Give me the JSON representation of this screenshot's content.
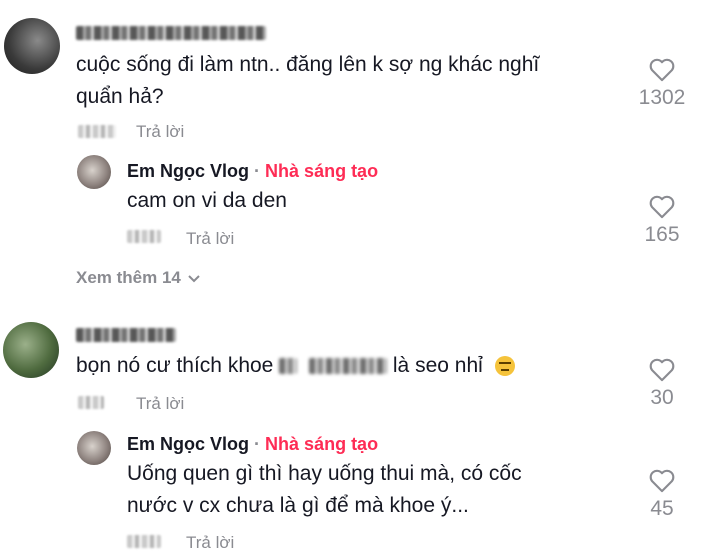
{
  "colors": {
    "creator_badge": "#fe2c55",
    "muted": "#8a8b91",
    "text": "#161823"
  },
  "reply_label": "Trả lời",
  "comments": [
    {
      "text_lines": [
        "cuộc sống đi làm ntn.. đăng lên k sợ ng khác nghĩ",
        "quẩn hả?"
      ],
      "likes": "1302",
      "replies": [
        {
          "author": "Em Ngọc Vlog",
          "separator": "·",
          "badge": "Nhà sáng tạo",
          "text_lines": [
            "cam on vi da den"
          ],
          "likes": "165"
        }
      ],
      "view_more": "Xem thêm 14"
    },
    {
      "text_before": "bọn nó cư thích khoe",
      "text_after": "là seo nhỉ",
      "emoji": "expressionless-face-emoji",
      "likes": "30",
      "replies": [
        {
          "author": "Em Ngọc Vlog",
          "separator": "·",
          "badge": "Nhà sáng tạo",
          "text_lines": [
            "Uống quen gì thì hay uống thui mà, có cốc",
            "nước v cx chưa là gì để mà khoe ý..."
          ],
          "likes": "45"
        }
      ]
    }
  ],
  "icons": {
    "like": "heart-outline-icon",
    "expand": "chevron-down-icon"
  }
}
